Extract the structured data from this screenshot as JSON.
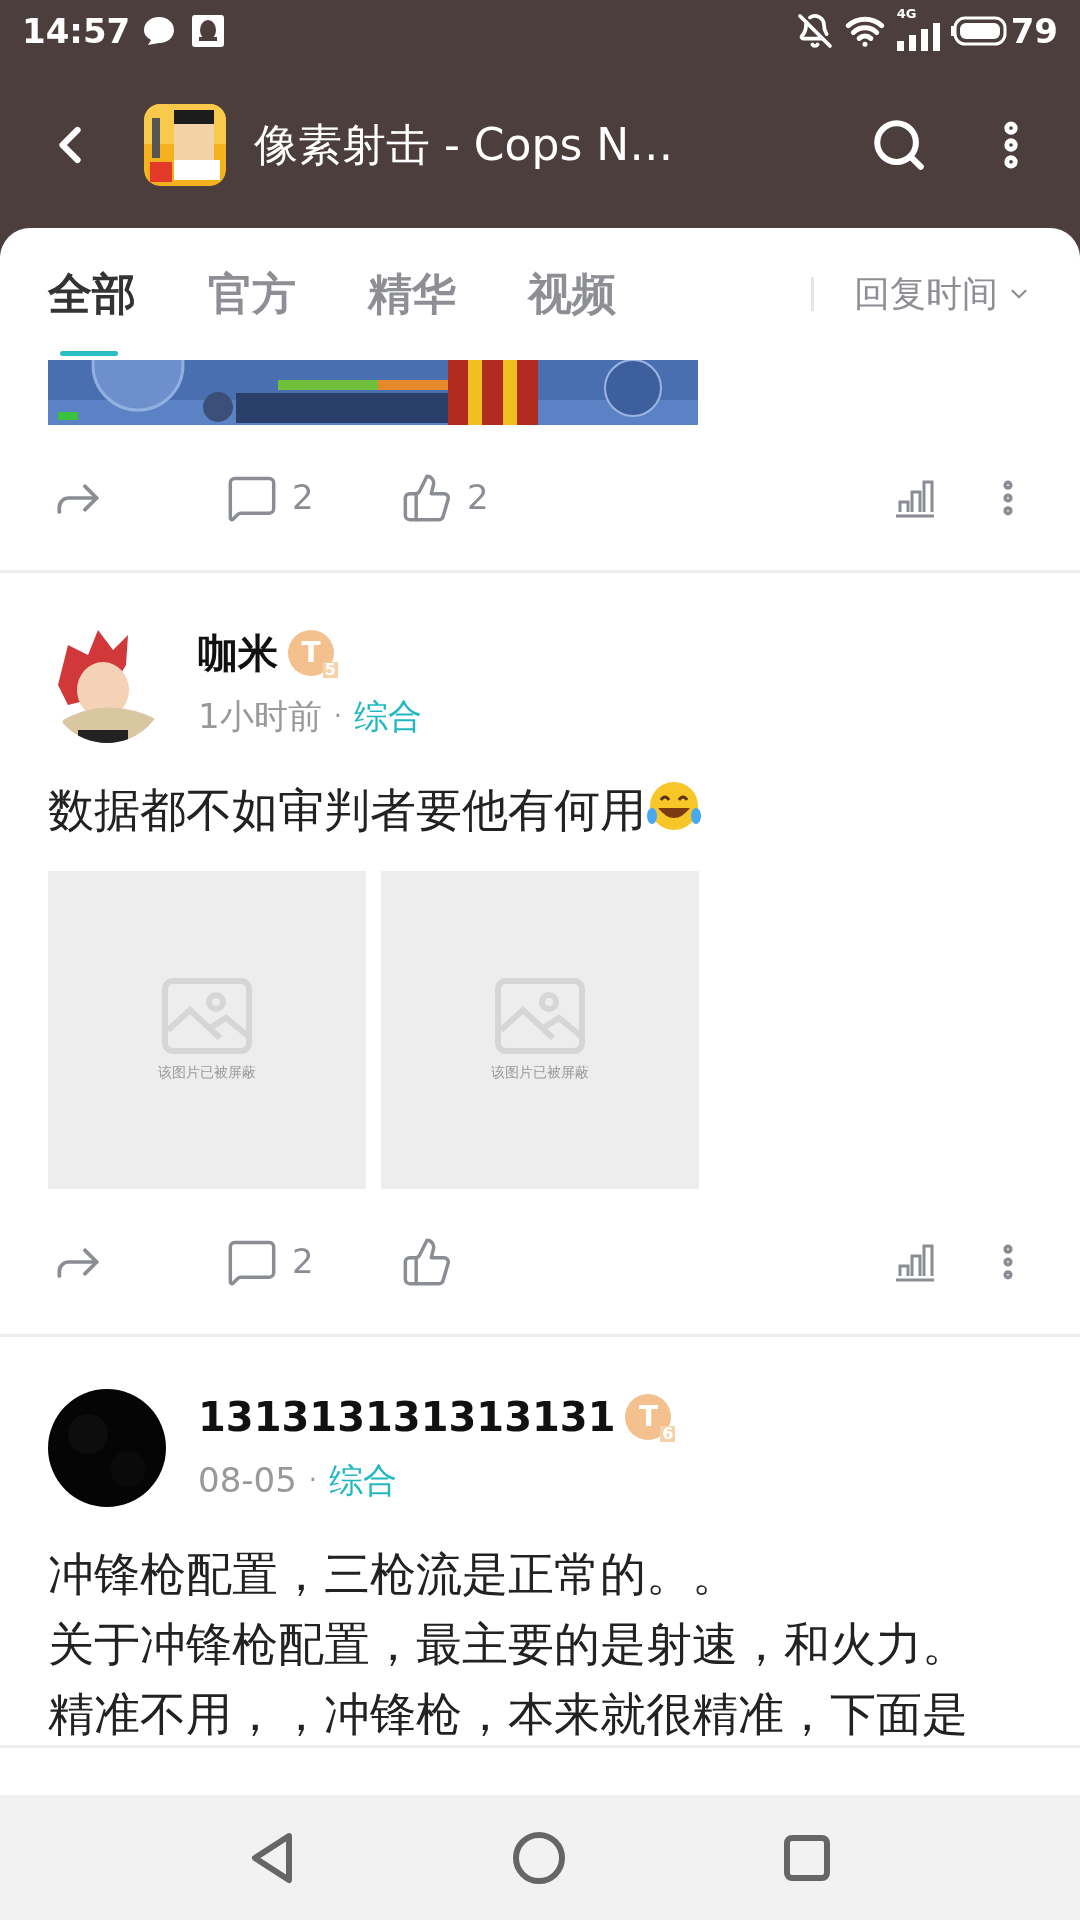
{
  "status_bar": {
    "time": "14:57",
    "network": "4G",
    "battery": "79"
  },
  "header": {
    "title": "像素射击 - Cops N…"
  },
  "tabs": [
    {
      "label": "全部",
      "selected": true
    },
    {
      "label": "官方",
      "selected": false
    },
    {
      "label": "精华",
      "selected": false
    },
    {
      "label": "视频",
      "selected": false
    }
  ],
  "sort": {
    "label": "回复时间"
  },
  "posts": [
    {
      "kind": "partial",
      "actions": {
        "comments": "2",
        "likes": "2"
      }
    },
    {
      "kind": "full",
      "avatar": {
        "kind": "illustration"
      },
      "author": "咖米",
      "badge": {
        "letter": "T",
        "level": "5"
      },
      "time": "1小时前",
      "separator": "·",
      "category": "综合",
      "text": [
        "数据都不如审判者要他有何用"
      ],
      "emoji": {
        "kind": "laughing"
      },
      "images": [
        {
          "caption": "该图片已被屏蔽"
        },
        {
          "caption": "该图片已被屏蔽"
        }
      ],
      "actions": {
        "comments": "2"
      }
    },
    {
      "kind": "full",
      "avatar": {
        "kind": "dark"
      },
      "author": "131313131313131",
      "badge": {
        "letter": "T",
        "level": "6"
      },
      "time": "08-05",
      "separator": "·",
      "category": "综合",
      "text": [
        "冲锋枪配置，三枪流是正常的。。",
        "关于冲锋枪配置，最主要的是射速，和火力。",
        "精准不用，，冲锋枪，本来就很精准，下面是"
      ]
    }
  ]
}
